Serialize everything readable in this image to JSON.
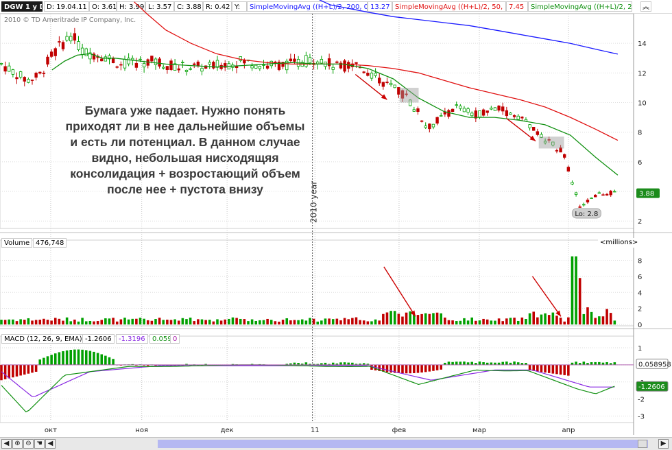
{
  "header": {
    "symbol": "DGW 1 y D",
    "date": "D: 19.04.11",
    "open": "O: 3.61",
    "high": "H: 3.99",
    "low": "L: 3.57",
    "close": "C: 3.88",
    "range": "R: 0.42",
    "y_label": "Y:",
    "sma200_label": "SimpleMovingAvg ((H+L)/2, 200, 0)",
    "sma200_value": "13.27",
    "sma50_label": "SimpleMovingAvg ((H+L)/2, 50, 0)",
    "sma50_value": "7.45",
    "sma20_label": "SimpleMovingAvg ((H+L)/2, 2...",
    "icon": "chevron-up-icon"
  },
  "copyright": "2010 © TD Ameritrade IP Company, Inc.",
  "annotation": {
    "lines": [
      "Бумага уже падает. Нужно понять",
      "приходят ли в нее дальнейшие объемы",
      "и есть ли потенциал. В данном случае",
      "видно, небольшая нисходящяя",
      "консолидация + возростающий объем",
      "после нее + пустота внизу"
    ]
  },
  "volume_header": {
    "label": "Volume",
    "value": "476,748",
    "unit": "<millions>"
  },
  "macd_header": {
    "label": "MACD (12, 26, 9, EMA)",
    "v1": "-1.2606",
    "v2": "-1.3196",
    "v3": "0.059",
    "v4": "0"
  },
  "colors": {
    "up": "#00a000",
    "down": "#c00000",
    "sma200": "#1a1aff",
    "sma50": "#e01010",
    "sma20": "#109010",
    "macd_signal": "#8a2be2",
    "arrow": "#cc0000",
    "price_badge": "#1c8c1c"
  },
  "chart_data": [
    {
      "type": "candlestick",
      "title": "DGW 1 y D",
      "ylim": [
        1.5,
        16
      ],
      "y_ticks": [
        2,
        4,
        6,
        8,
        10,
        12,
        14
      ],
      "x_ticks": [
        "окт",
        "ноя",
        "дек",
        "11",
        "фев",
        "мар",
        "апр"
      ],
      "year_marker": "2010 year",
      "last_price": "3.88",
      "low_badge": "Lo: 2.8",
      "series": [
        {
          "name": "SimpleMovingAvg ((H+L)/2, 200, 0)",
          "x": [
            0.5,
            0.52,
            0.58,
            0.62,
            0.66,
            0.7,
            0.74,
            0.78,
            0.82,
            0.86,
            0.9,
            0.94,
            0.975
          ],
          "values": [
            17.0,
            16.6,
            16.1,
            15.8,
            15.6,
            15.4,
            15.2,
            14.9,
            14.6,
            14.3,
            14.0,
            13.6,
            13.27
          ]
        },
        {
          "name": "SimpleMovingAvg ((H+L)/2, 50, 0)",
          "x": [
            0.21,
            0.23,
            0.26,
            0.3,
            0.34,
            0.38,
            0.42,
            0.46,
            0.5,
            0.54,
            0.58,
            0.62,
            0.66,
            0.7,
            0.74,
            0.78,
            0.82,
            0.86,
            0.9,
            0.94,
            0.975
          ],
          "values": [
            16.8,
            16.0,
            14.9,
            14.0,
            13.3,
            12.9,
            12.7,
            12.6,
            12.6,
            12.6,
            12.5,
            12.3,
            12.0,
            11.5,
            11.0,
            10.6,
            10.2,
            9.7,
            9.0,
            8.2,
            7.45
          ]
        },
        {
          "name": "SimpleMovingAvg ((H+L)/2, 2...",
          "x": [
            0.08,
            0.1,
            0.12,
            0.14,
            0.16,
            0.18,
            0.22,
            0.26,
            0.3,
            0.34,
            0.38,
            0.42,
            0.46,
            0.5,
            0.54,
            0.58,
            0.62,
            0.66,
            0.7,
            0.74,
            0.78,
            0.82,
            0.86,
            0.9,
            0.94,
            0.975
          ],
          "values": [
            12.2,
            12.8,
            13.2,
            13.3,
            13.0,
            13.0,
            12.8,
            12.6,
            12.5,
            12.4,
            12.5,
            12.6,
            12.7,
            12.6,
            12.6,
            12.3,
            11.6,
            10.3,
            9.4,
            9.0,
            9.0,
            8.8,
            8.5,
            7.8,
            6.3,
            5.1
          ]
        }
      ],
      "arrows": [
        {
          "x1": 0.56,
          "y1": 11.9,
          "x2": 0.61,
          "y2": 10.2
        },
        {
          "x1": 0.8,
          "y1": 8.9,
          "x2": 0.845,
          "y2": 7.4
        }
      ],
      "consolidation_boxes": [
        {
          "x1": 0.63,
          "x2": 0.66,
          "y1": 10.0,
          "y2": 11.0
        },
        {
          "x1": 0.85,
          "x2": 0.89,
          "y1": 6.9,
          "y2": 7.7
        }
      ]
    },
    {
      "type": "bar",
      "title": "Volume",
      "ylim": [
        0,
        9.5
      ],
      "y_ticks": [
        0,
        2,
        4,
        6,
        8
      ],
      "unit": "millions",
      "arrows": [
        {
          "x1": 0.605,
          "y1": 7.2,
          "x2": 0.655,
          "y2": 1.0
        },
        {
          "x1": 0.84,
          "y1": 6.0,
          "x2": 0.885,
          "y2": 1.0
        }
      ]
    },
    {
      "type": "line",
      "title": "MACD (12, 26, 9, EMA)",
      "ylim": [
        -3.3,
        1.2
      ],
      "y_ticks": [
        -3,
        -2,
        -1,
        0,
        1
      ],
      "value_badges": [
        "0.058958",
        "-1.2606"
      ]
    }
  ]
}
